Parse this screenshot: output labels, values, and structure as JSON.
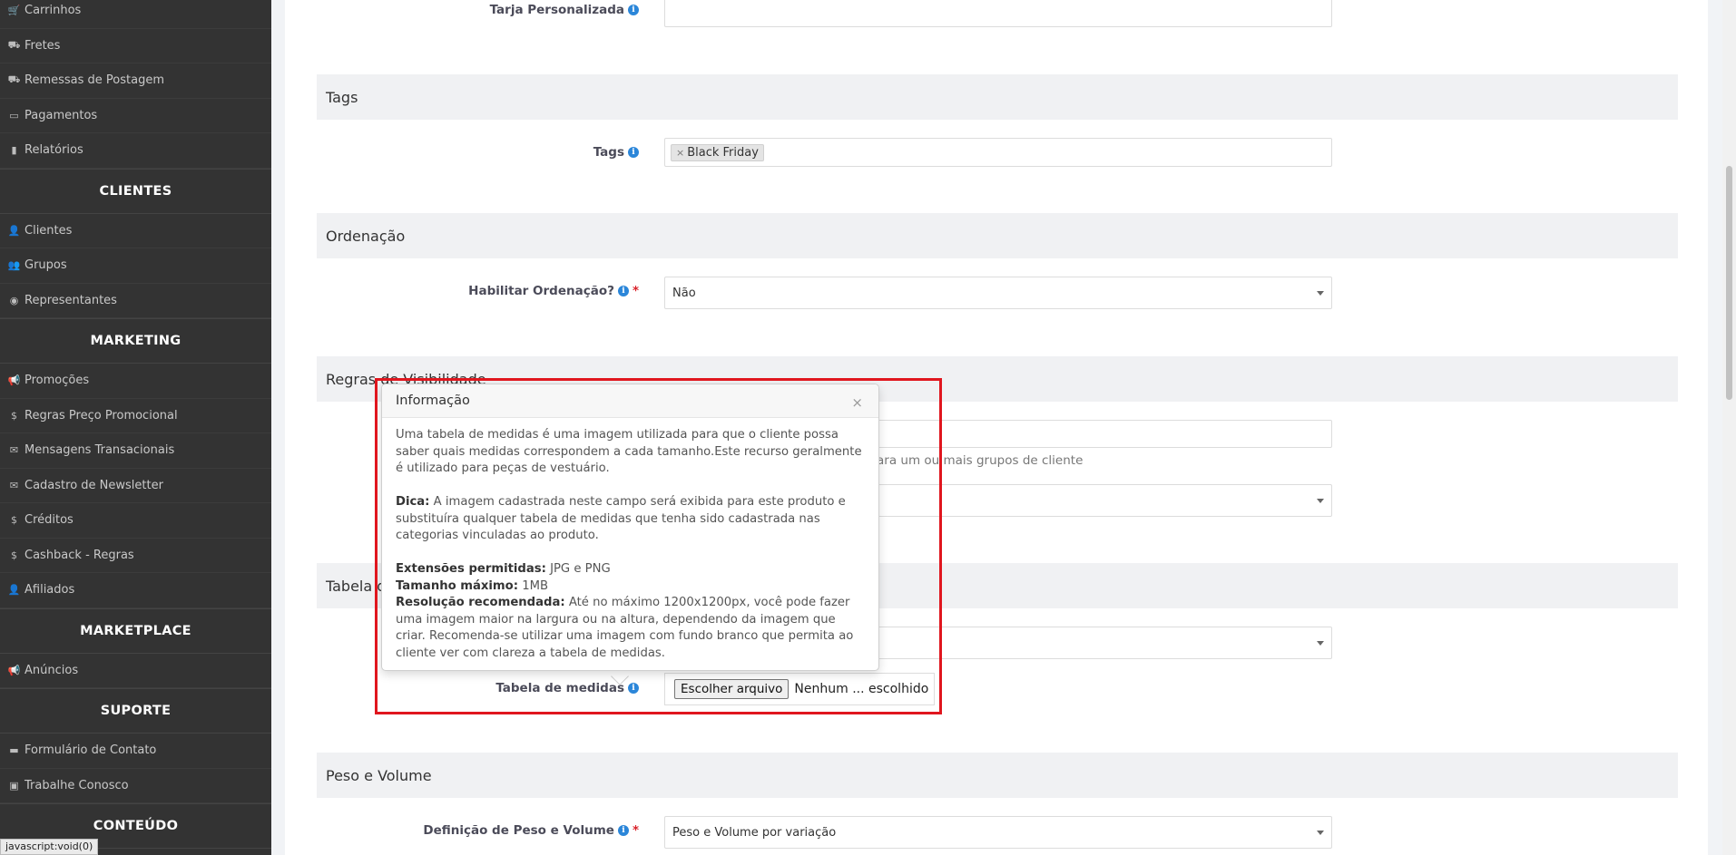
{
  "sidebar": {
    "items_top": [
      {
        "label": "Carrinhos",
        "icon": "cart-icon"
      },
      {
        "label": "Fretes",
        "icon": "truck-icon"
      },
      {
        "label": "Remessas de Postagem",
        "icon": "truck-icon"
      },
      {
        "label": "Pagamentos",
        "icon": "credit-card-icon"
      },
      {
        "label": "Relatórios",
        "icon": "bar-chart-icon"
      }
    ],
    "clientes_heading": "CLIENTES",
    "clientes_items": [
      {
        "label": "Clientes",
        "icon": "user-icon"
      },
      {
        "label": "Grupos",
        "icon": "users-icon"
      },
      {
        "label": "Representantes",
        "icon": "user-circle-icon"
      }
    ],
    "marketing_heading": "MARKETING",
    "marketing_items": [
      {
        "label": "Promoções",
        "icon": "bullhorn-icon"
      },
      {
        "label": "Regras Preço Promocional",
        "icon": "dollar-icon"
      },
      {
        "label": "Mensagens Transacionais",
        "icon": "envelope-icon"
      },
      {
        "label": "Cadastro de Newsletter",
        "icon": "envelope-icon"
      },
      {
        "label": "Créditos",
        "icon": "dollar-icon"
      },
      {
        "label": "Cashback - Regras",
        "icon": "dollar-icon"
      },
      {
        "label": "Afiliados",
        "icon": "user-icon"
      }
    ],
    "marketplace_heading": "MARKETPLACE",
    "marketplace_items": [
      {
        "label": "Anúncios",
        "icon": "bullhorn-icon"
      }
    ],
    "suporte_heading": "SUPORTE",
    "suporte_items": [
      {
        "label": "Formulário de Contato",
        "icon": "comment-icon"
      },
      {
        "label": "Trabalhe Conosco",
        "icon": "briefcase-icon"
      }
    ],
    "conteudo_heading": "CONTEÚDO",
    "status_url": "javascript:void(0)"
  },
  "form": {
    "tarja_label": "Tarja Personalizada",
    "tags_section": "Tags",
    "tags_label": "Tags",
    "tags_values": [
      "Black Friday"
    ],
    "ordenacao_section": "Ordenação",
    "habilitar_ordenacao_label": "Habilitar Ordenação?",
    "habilitar_ordenacao_value": "Não",
    "visibilidade_section": "Regras de Visibilidade",
    "visibilidade_help_fragment": "ara um ou mais grupos de cliente",
    "tabela_section_fragment": "Tabela d",
    "tabela_medidas_label": "Tabela de medidas",
    "file_button": "Escolher arquivo",
    "file_status": "Nenhum ... escolhido",
    "peso_section": "Peso e Volume",
    "peso_label": "Definição de Peso e Volume",
    "peso_value": "Peso e Volume por variação"
  },
  "popover": {
    "title": "Informação",
    "close": "×",
    "intro": "Uma tabela de medidas é uma imagem utilizada para que o cliente possa saber quais medidas correspondem a cada tamanho.Este recurso geralmente é utilizado para peças de vestuário.",
    "dica_label": "Dica:",
    "dica_text": " A imagem cadastrada neste campo será exibida para este produto e substituíra qualquer tabela de medidas que tenha sido cadastrada nas categorias vinculadas ao produto.",
    "ext_label": "Extensões permitidas:",
    "ext_text": " JPG e PNG",
    "size_label": "Tamanho máximo:",
    "size_text": " 1MB",
    "res_label": "Resolução recomendada:",
    "res_text": " Até no máximo 1200x1200px, você pode fazer uma imagem maior na largura ou na altura, dependendo da imagem que criar. Recomenda-se utilizar uma imagem com fundo branco que permita ao cliente ver com clareza a tabela de medidas."
  },
  "colors": {
    "sidebar_bg": "#333333",
    "highlight": "#e0161e",
    "info_icon": "#2b86d9",
    "required": "#d9222a"
  }
}
